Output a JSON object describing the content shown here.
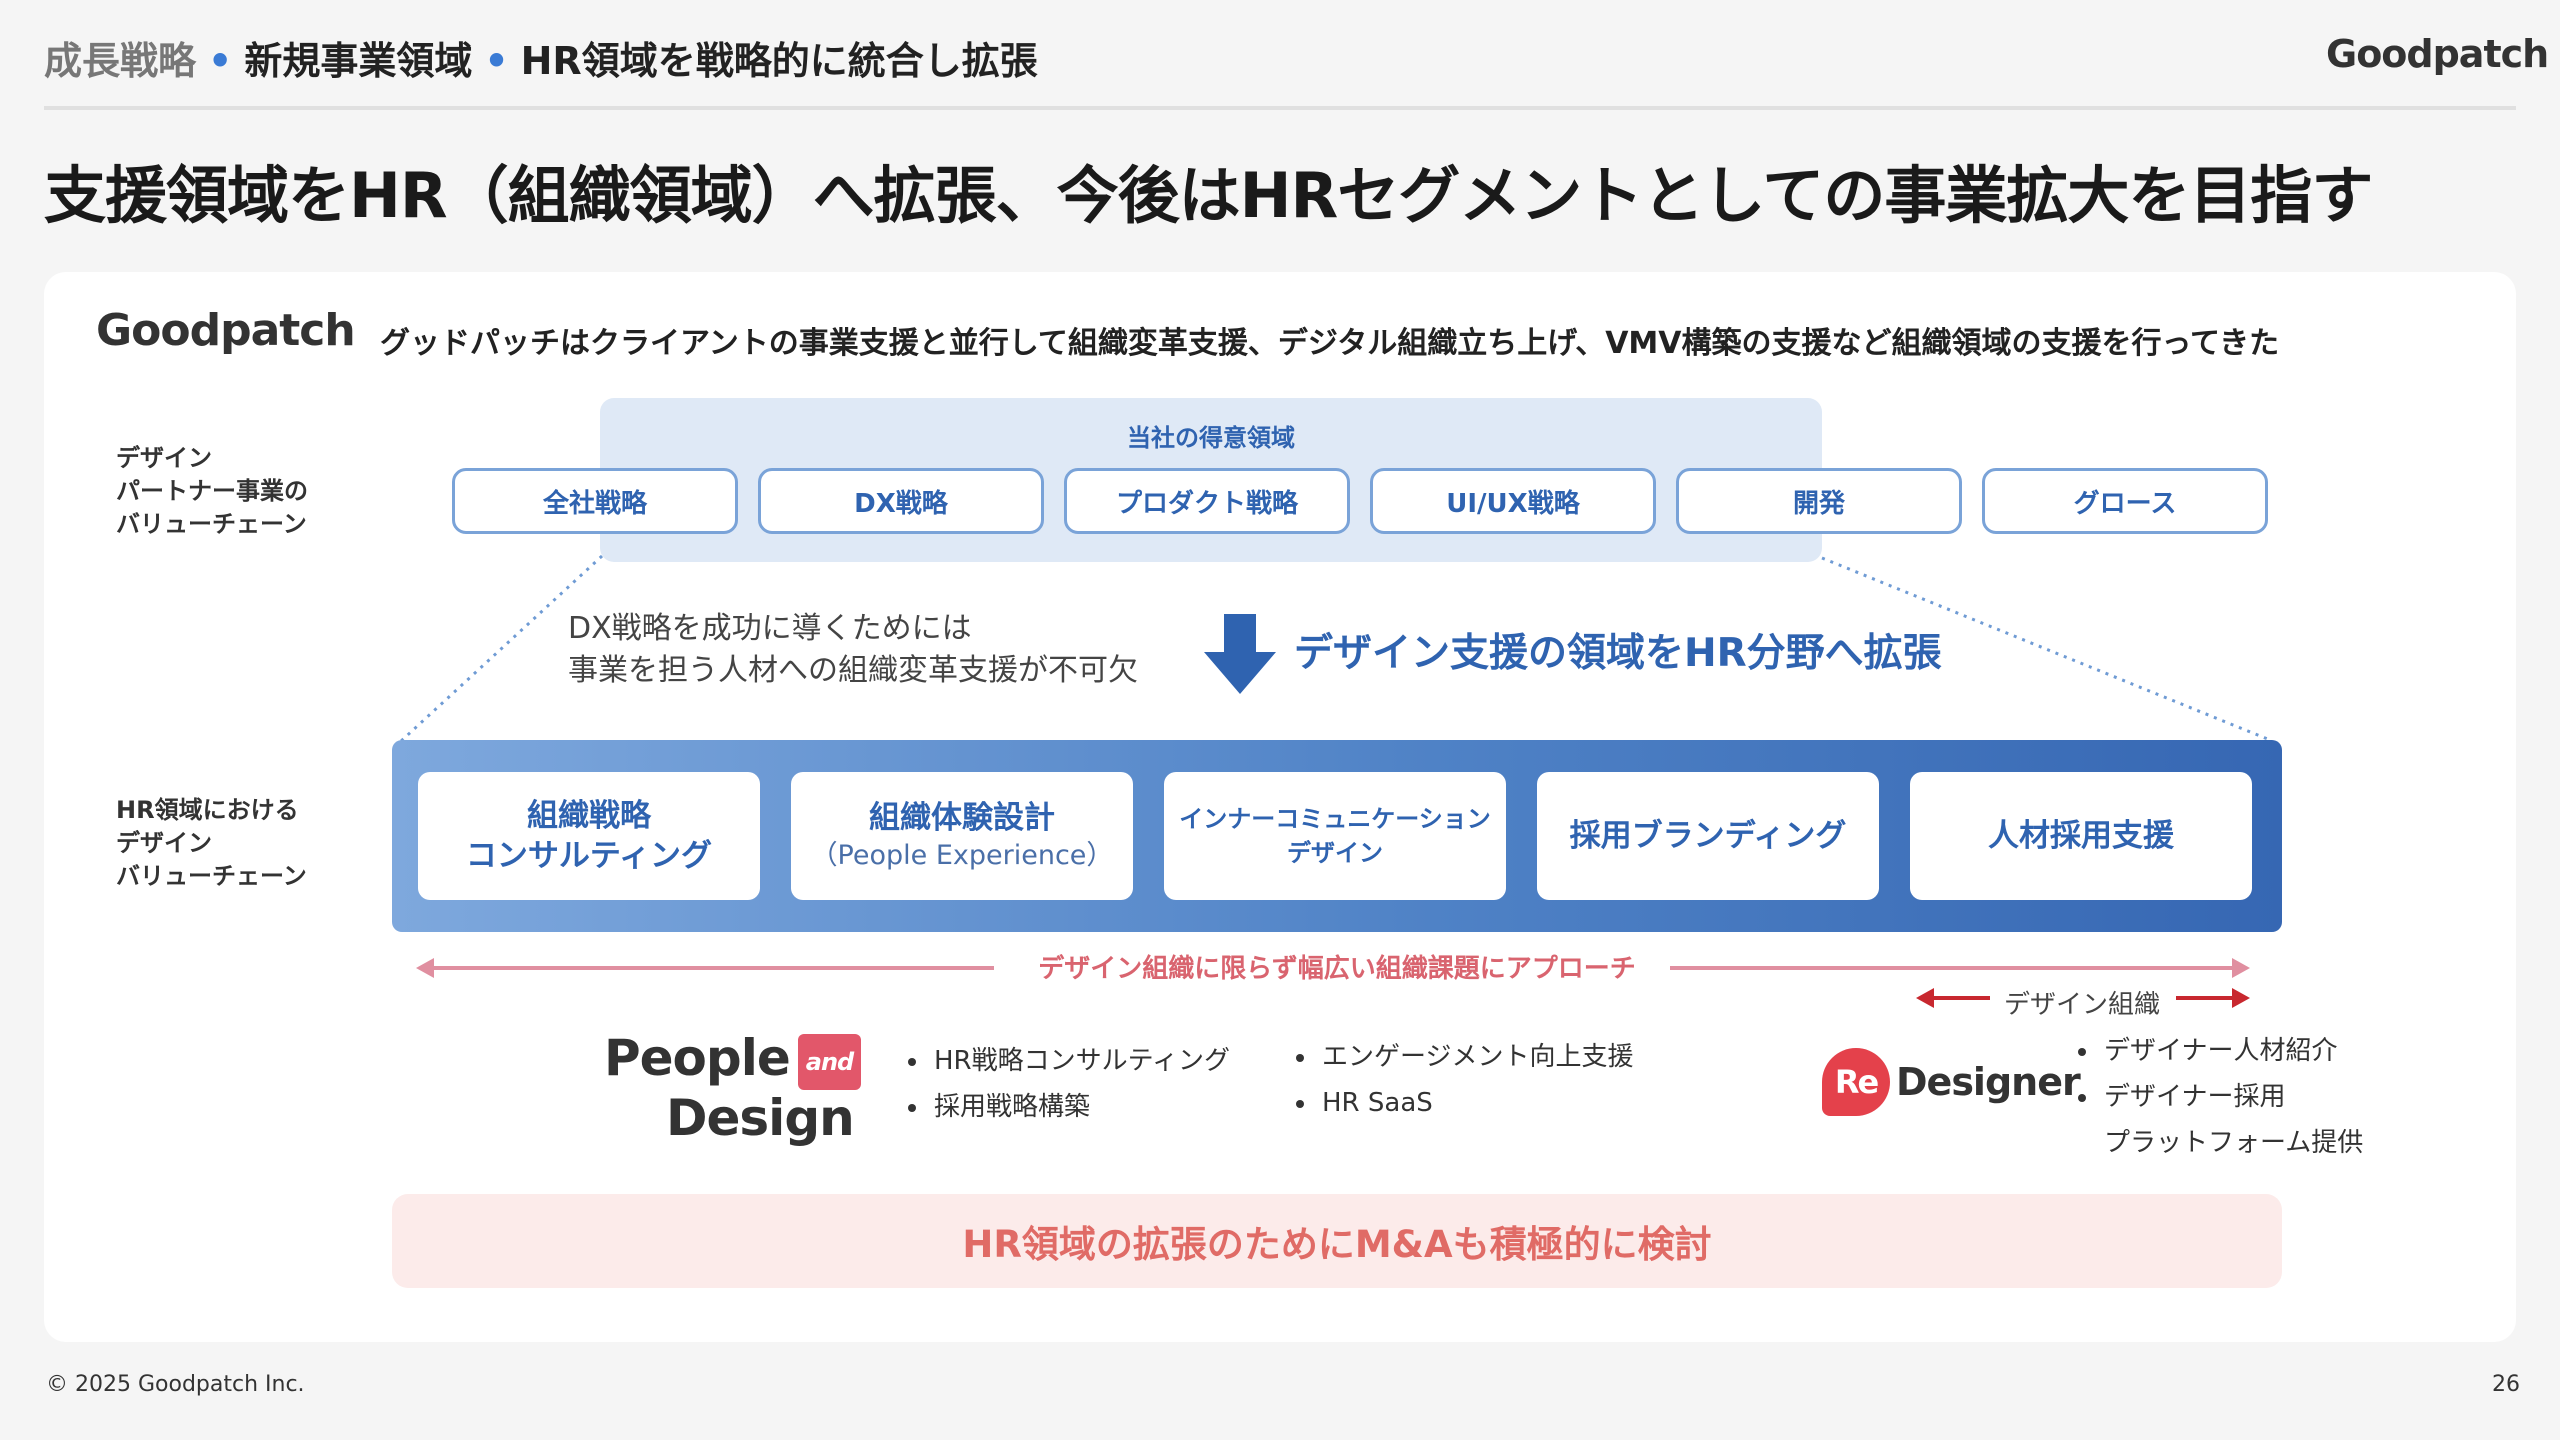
{
  "header": {
    "breadcrumb": [
      "成長戦略",
      "新規事業領域",
      "HR領域を戦略的に統合し拡張"
    ],
    "logo": "Goodpatch"
  },
  "title": "支援領域をHR（組織領域）へ拡張、今後はHRセグメントとしての事業拡大を目指す",
  "card": {
    "logo": "Goodpatch",
    "description": "グッドパッチはクライアントの事業支援と並行して組織変革支援、デジタル組織立ち上げ、VMV構築の支援など組織領域の支援を行ってきた"
  },
  "value_chain": {
    "side_label": [
      "デザイン",
      "パートナー事業の",
      "バリューチェーン"
    ],
    "strength_title": "当社の得意領域",
    "items": [
      "全社戦略",
      "DX戦略",
      "プロダクト戦略",
      "UI/UX戦略",
      "開発",
      "グロース"
    ]
  },
  "expansion": {
    "lines": [
      "DX戦略を成功に導くためには",
      "事業を担う人材への組織変革支援が不可欠"
    ],
    "headline": "デザイン支援の領域をHR分野へ拡張"
  },
  "hr_chain": {
    "side_label": [
      "HR領域における",
      "デザイン",
      "バリューチェーン"
    ],
    "items": [
      {
        "line1": "組織戦略",
        "line2": "コンサルティング"
      },
      {
        "line1": "組織体験設計",
        "line2": "（People Experience）"
      },
      {
        "line1": "インナーコミュニケーション",
        "line2": "デザイン"
      },
      {
        "line1": "採用ブランディング"
      },
      {
        "line1": "人材採用支援"
      }
    ]
  },
  "approach": "デザイン組織に限らず幅広い組織課題にアプローチ",
  "people_design": {
    "logo_line1": "People",
    "logo_and": "and",
    "logo_line2": "Design",
    "bullets_a": [
      "HR戦略コンサルティング",
      "採用戦略構築"
    ],
    "bullets_b": [
      "エンゲージメント向上支援",
      "HR SaaS"
    ]
  },
  "redesigner": {
    "design_org_label": "デザイン組織",
    "logo_badge": "Re",
    "logo_text": "Designer",
    "bullets": [
      "デザイナー人材紹介",
      "デザイナー採用",
      "プラットフォーム提供"
    ]
  },
  "ma_text": "HR領域の拡張のためにM&Aも積極的に検討",
  "footer": {
    "copyright": "© 2025 Goodpatch Inc.",
    "page": "26"
  },
  "colors": {
    "accent_blue": "#2f63b0",
    "accent_pink": "#d9646f",
    "redesigner_red": "#e4414b"
  }
}
